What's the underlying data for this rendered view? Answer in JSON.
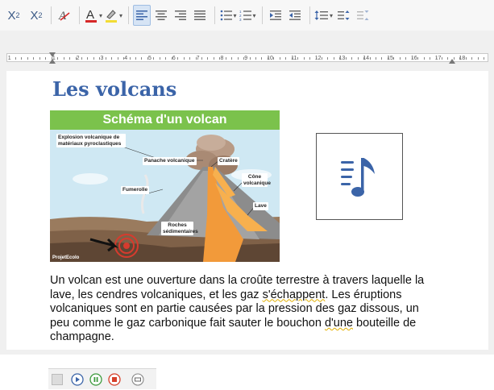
{
  "toolbar": {
    "superscript_label": "X",
    "superscript_mark": "2",
    "subscript_label": "X",
    "subscript_mark": "2",
    "font_color_label": "A",
    "colors": {
      "font": "#d62828",
      "highlight": "#f2dc35",
      "accent": "#3b64a8"
    }
  },
  "ruler": {
    "numbers": [
      "1",
      "1",
      "2",
      "3",
      "4",
      "5",
      "6",
      "7",
      "8",
      "9",
      "10",
      "11",
      "12",
      "13",
      "14",
      "15",
      "16",
      "17",
      "18"
    ]
  },
  "document": {
    "title": "Les volcans",
    "figure": {
      "banner": "Schéma d'un volcan",
      "labels": {
        "explosion": "Explosion volcanique de matériaux pyroclastiques",
        "panache": "Panache volcanique",
        "cratere": "Cratère",
        "cone": "Cône volcanique",
        "fumerolle": "Fumerolle",
        "lave": "Lave",
        "roches": "Roches sédimentaires"
      },
      "brand": "ProjetEcolo"
    },
    "audio_icon": "music-note-list-icon",
    "paragraph": {
      "line1": "Un volcan est une ouverture dans la croûte terrestre à travers laquelle la",
      "line2_a": "lave, les cendres volcaniques, et les gaz ",
      "line2_b": "s'échappent",
      "line2_c": ". Les éruptions",
      "line3": "volcaniques sont en partie causées par la pression des gaz dissous, un",
      "line4_a": "peu comme le gaz carbonique fait sauter le bouchon ",
      "line4_b": "d'une",
      "line4_c": " bouteille de",
      "line5": "champagne."
    }
  },
  "player": {
    "icons": [
      "media-placeholder-icon",
      "play-icon",
      "pause-icon",
      "stop-icon",
      "options-icon"
    ]
  }
}
